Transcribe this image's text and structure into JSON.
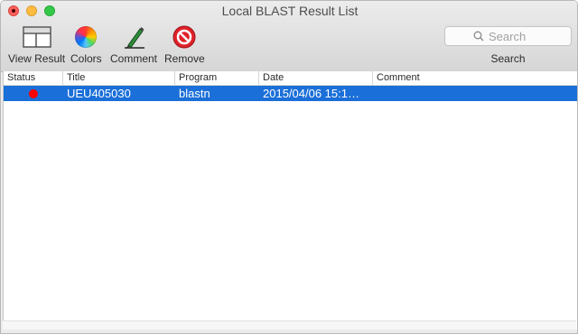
{
  "window": {
    "title": "Local BLAST Result List"
  },
  "toolbar": {
    "view_result": "View Result",
    "colors": "Colors",
    "comment": "Comment",
    "remove": "Remove"
  },
  "search": {
    "placeholder": "Search",
    "label": "Search"
  },
  "table": {
    "columns": [
      "Status",
      "Title",
      "Program",
      "Date",
      "Comment"
    ],
    "rows": [
      {
        "status_color": "#ff0000",
        "title": "UEU405030",
        "program": "blastn",
        "date": "2015/04/06 15:1…",
        "comment": ""
      }
    ],
    "selected_row_color": "#1b6fd8"
  }
}
